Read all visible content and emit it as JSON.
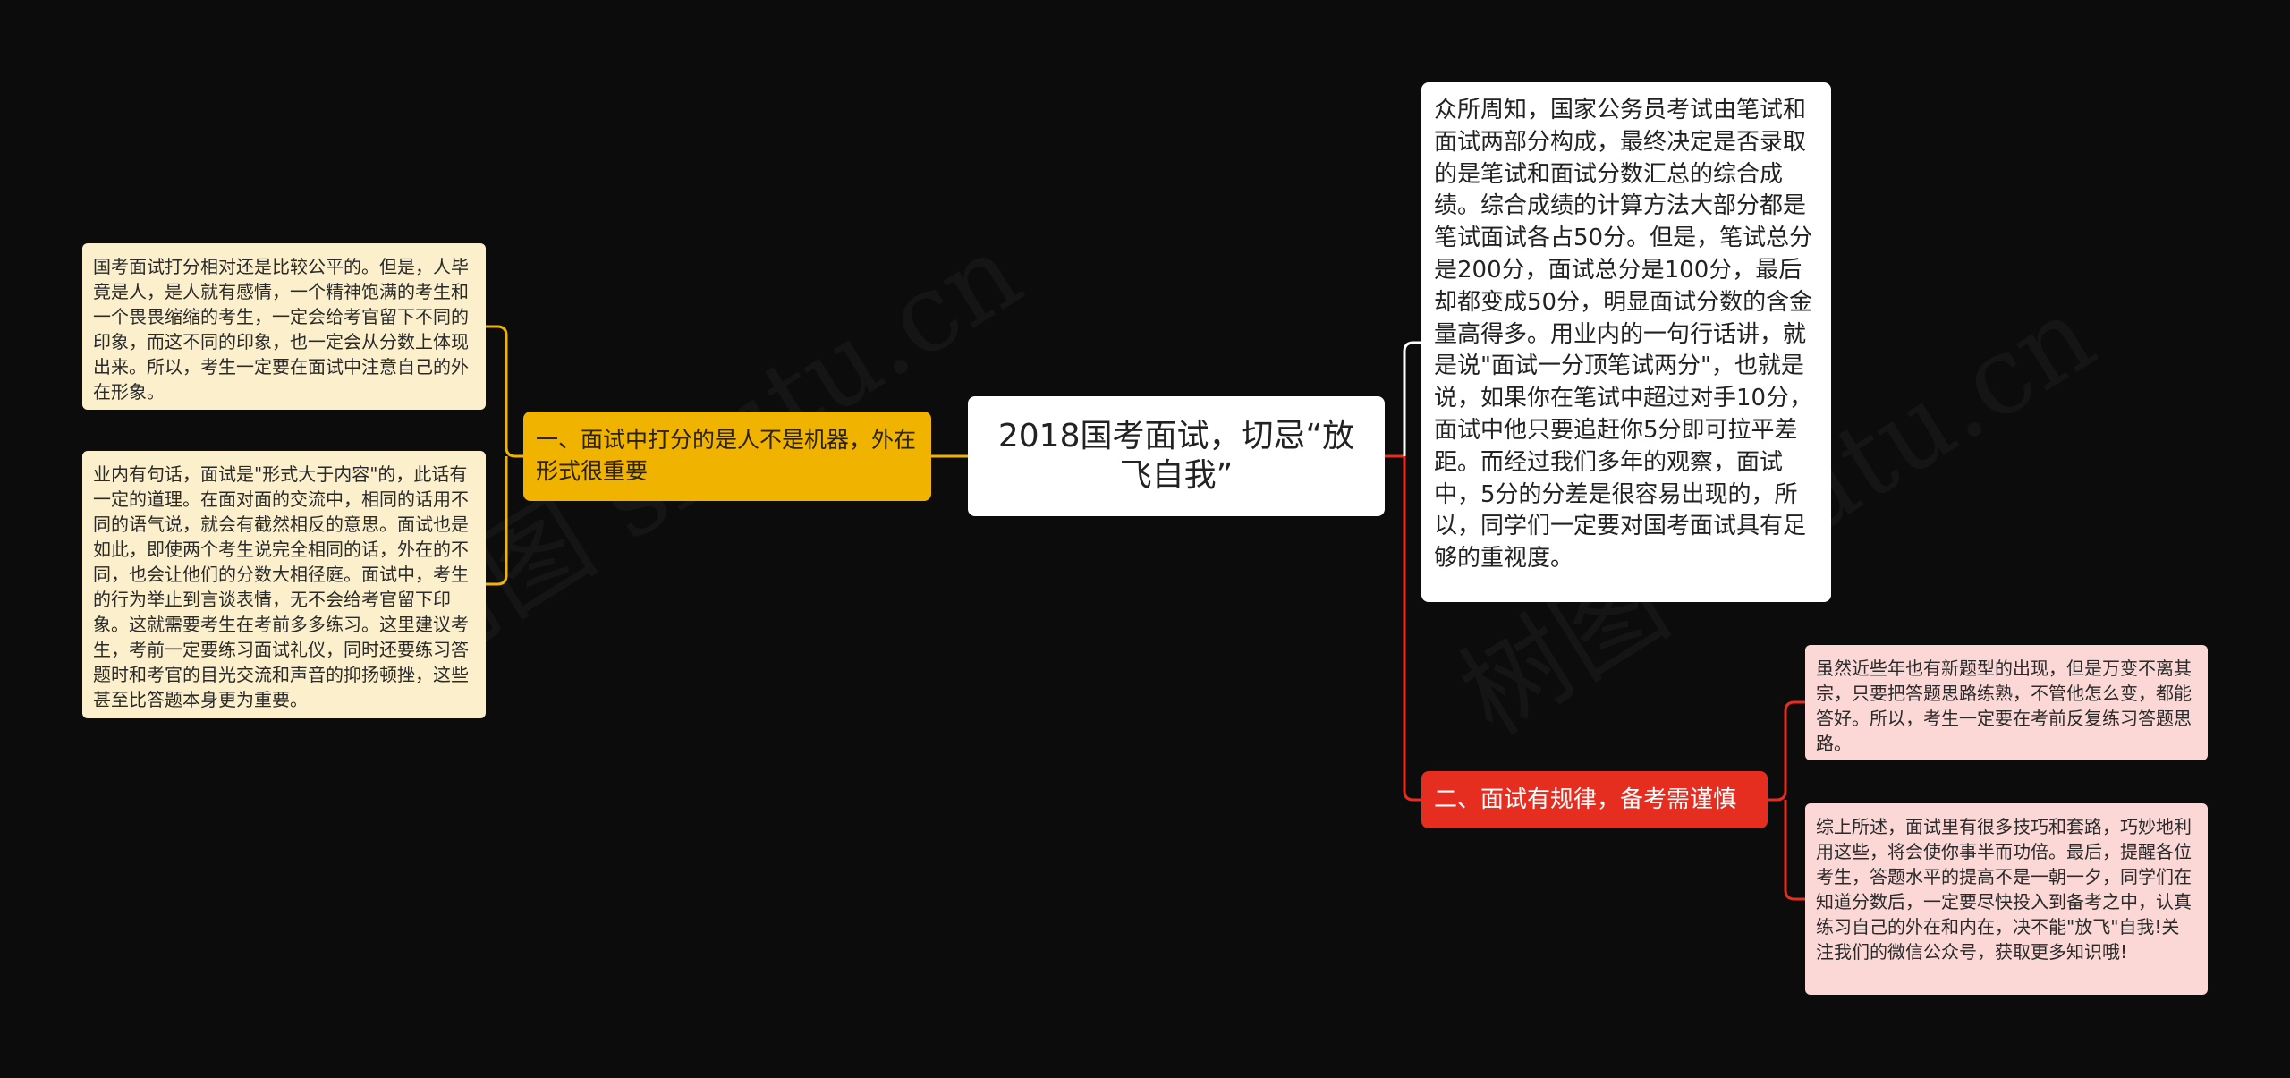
{
  "root": {
    "title": "2018国考面试，切忌“放飞自我”"
  },
  "intro": "众所周知，国家公务员考试由笔试和面试两部分构成，最终决定是否录取的是笔试和面试分数汇总的综合成绩。综合成绩的计算方法大部分都是笔试面试各占50分。但是，笔试总分是200分，面试总分是100分，最后却都变成50分，明显面试分数的含金量高得多。用业内的一句行话讲，就是说\"面试一分顶笔试两分\"，也就是说，如果你在笔试中超过对手10分，面试中他只要追赶你5分即可拉平差距。而经过我们多年的观察，面试中，5分的分差是很容易出现的，所以，同学们一定要对国考面试具有足够的重视度。",
  "branch1": {
    "label": "一、面试中打分的是人不是机器，外在形式很重要",
    "leaves": [
      "国考面试打分相对还是比较公平的。但是，人毕竟是人，是人就有感情，一个精神饱满的考生和一个畏畏缩缩的考生，一定会给考官留下不同的印象，而这不同的印象，也一定会从分数上体现出来。所以，考生一定要在面试中注意自己的外在形象。",
      "业内有句话，面试是\"形式大于内容\"的，此话有一定的道理。在面对面的交流中，相同的话用不同的语气说，就会有截然相反的意思。面试也是如此，即使两个考生说完全相同的话，外在的不同，也会让他们的分数大相径庭。面试中，考生的行为举止到言谈表情，无不会给考官留下印象。这就需要考生在考前多多练习。这里建议考生，考前一定要练习面试礼仪，同时还要练习答题时和考官的目光交流和声音的抑扬顿挫，这些甚至比答题本身更为重要。"
    ]
  },
  "branch2": {
    "label": "二、面试有规律，备考需谨慎",
    "leaves": [
      "虽然近些年也有新题型的出现，但是万变不离其宗，只要把答题思路练熟，不管他怎么变，都能答好。所以，考生一定要在考前反复练习答题思路。",
      "综上所述，面试里有很多技巧和套路，巧妙地利用这些，将会使你事半而功倍。最后，提醒各位考生，答题水平的提高不是一朝一夕，同学们在知道分数后，一定要尽快投入到备考之中，认真练习自己的外在和内在，决不能\"放飞\"自我!关注我们的微信公众号，获取更多知识哦!"
    ]
  },
  "watermark": "树图 shutu.cn",
  "colors": {
    "background": "#0c0c0c",
    "branch1": "#f0b400",
    "branch2": "#e52e20",
    "leaf_yellow": "#fcf0cc",
    "leaf_pink": "#fbd8d6",
    "root": "#ffffff"
  }
}
